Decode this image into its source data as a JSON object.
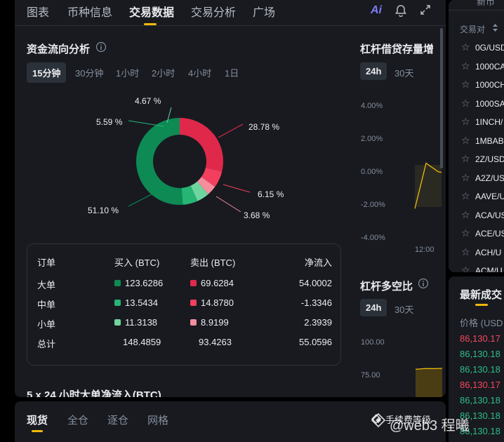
{
  "nav": {
    "tabs": [
      "图表",
      "币种信息",
      "交易数据",
      "交易分析",
      "广场"
    ],
    "active_tab": "交易数据",
    "ai_label": "Ai"
  },
  "fund_flow": {
    "title": "资金流向分析",
    "intervals": [
      "15分钟",
      "30分钟",
      "1小时",
      "2小时",
      "4小时",
      "1日"
    ],
    "selected_interval": "15分钟",
    "donut_labels": {
      "sell_large": "28.78 %",
      "sell_medium": "6.15 %",
      "sell_small": "3.68 %",
      "buy_large": "51.10 %",
      "buy_medium": "5.59 %",
      "buy_small": "4.67 %"
    },
    "table": {
      "headers": [
        "订单",
        "买入 (BTC)",
        "卖出 (BTC)",
        "净流入"
      ],
      "rows": [
        {
          "label": "大单",
          "buy": "123.6286",
          "sell": "69.6284",
          "net": "54.0002"
        },
        {
          "label": "中单",
          "buy": "13.5434",
          "sell": "14.8780",
          "net": "-1.3346"
        },
        {
          "label": "小单",
          "buy": "11.3138",
          "sell": "8.9199",
          "net": "2.3939"
        },
        {
          "label": "总计",
          "buy": "148.4859",
          "sell": "93.4263",
          "net": "55.0596"
        }
      ]
    },
    "next_section_title": "5 x 24 小时大单净流入(BTC)"
  },
  "chart_data": [
    {
      "type": "pie",
      "categories": [
        "大单卖出",
        "中单卖出",
        "小单卖出",
        "小单买入",
        "中单买入",
        "大单买入"
      ],
      "values": [
        28.78,
        6.15,
        3.68,
        4.67,
        5.59,
        51.1
      ],
      "colors": [
        "#e0294a",
        "#f23f5d",
        "#f28e9e",
        "#6fd59e",
        "#27b574",
        "#0e8a55"
      ]
    },
    {
      "type": "line",
      "title": "杠杆借贷存量增",
      "y_ticks": [
        "4.00%",
        "2.00%",
        "0.00%",
        "-2.00%",
        "-4.00%"
      ],
      "x_ticks": [
        "12:00"
      ],
      "ylim": [
        -4,
        4
      ],
      "x": [
        0,
        1,
        2,
        3
      ],
      "values": [
        -2.6,
        0.1,
        -0.4,
        -0.45
      ]
    },
    {
      "type": "area",
      "title": "杠杆多空比",
      "y_ticks": [
        "100.00",
        "75.00"
      ],
      "values": [
        79.6,
        80.2,
        80.1,
        80.3
      ]
    }
  ],
  "margin_growth": {
    "title": "杠杆借贷存量增",
    "intervals": [
      "24h",
      "30天"
    ],
    "selected": "24h"
  },
  "long_short": {
    "title": "杠杆多空比",
    "intervals": [
      "24h",
      "30天"
    ],
    "selected": "24h"
  },
  "bottom_tabs": {
    "tabs": [
      "现货",
      "全仓",
      "逐仓",
      "网格"
    ],
    "active": "现货",
    "fee_label": "手续费等级"
  },
  "pairs_panel": {
    "header_top": "新币",
    "sort_label": "交易对",
    "pairs": [
      "0G/USD",
      "1000CA",
      "1000CH",
      "1000SA",
      "1INCH/",
      "1MBAB",
      "2Z/USD",
      "A2Z/US",
      "AAVE/U",
      "ACA/US",
      "ACE/US",
      "ACH/U",
      "ACM/U"
    ]
  },
  "trades_panel": {
    "title": "最新成交",
    "price_header": "价格 (USD",
    "trades": [
      {
        "price": "86,130.17",
        "color": "#f6465d"
      },
      {
        "price": "86,130.18",
        "color": "#2ebd85"
      },
      {
        "price": "86,130.18",
        "color": "#2ebd85"
      },
      {
        "price": "86,130.17",
        "color": "#f6465d"
      },
      {
        "price": "86,130.18",
        "color": "#2ebd85"
      },
      {
        "price": "86,130.18",
        "color": "#2ebd85"
      },
      {
        "price": "86,130.18",
        "color": "#2ebd85"
      }
    ]
  },
  "watermark": "@web3 程曦"
}
